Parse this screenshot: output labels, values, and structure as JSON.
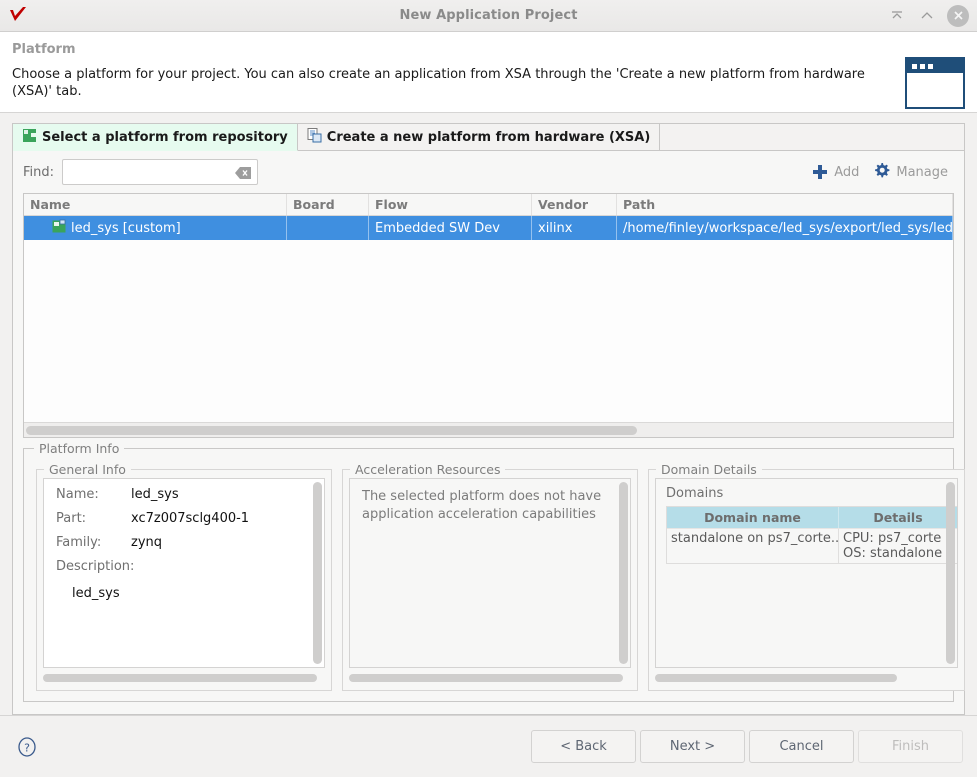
{
  "window": {
    "title": "New Application Project",
    "app_icon": "vitis-checkmark-icon",
    "controls": {
      "minimize": "collapse-icon",
      "maximize": "chevron-up-icon",
      "close": "close-icon"
    }
  },
  "header": {
    "title": "Platform",
    "description": "Choose a platform for your project. You can also create an application from XSA through the 'Create a new platform from hardware (XSA)' tab."
  },
  "tabs": [
    {
      "label": "Select a platform from repository",
      "icon": "green-platform-icon",
      "active": true
    },
    {
      "label": "Create a new platform from hardware (XSA)",
      "icon": "xsa-document-icon",
      "active": false
    }
  ],
  "find": {
    "label": "Find:",
    "value": "",
    "placeholder": "",
    "clear_icon": "clear-backspace-icon"
  },
  "toolbar": {
    "add_label": "Add",
    "add_icon": "plus-icon",
    "manage_label": "Manage",
    "manage_icon": "gear-icon"
  },
  "platform_table": {
    "columns": [
      "Name",
      "Board",
      "Flow",
      "Vendor",
      "Path"
    ],
    "rows": [
      {
        "name": "led_sys [custom]",
        "board": "",
        "flow": "Embedded SW Dev",
        "vendor": "xilinx",
        "path": "/home/finley/workspace/led_sys/export/led_sys/led_s",
        "icon": "platform-project-icon",
        "selected": true
      }
    ]
  },
  "platform_info": {
    "legend": "Platform Info",
    "general": {
      "legend": "General Info",
      "fields": [
        {
          "key": "Name:",
          "value": "led_sys"
        },
        {
          "key": "Part:",
          "value": "xc7z007sclg400-1"
        },
        {
          "key": "Family:",
          "value": "zynq"
        }
      ],
      "description_key": "Description:",
      "description_value": "led_sys"
    },
    "acceleration": {
      "legend": "Acceleration Resources",
      "message": "The selected platform does not have application acceleration capabilities"
    },
    "domain_details": {
      "legend": "Domain Details",
      "domains_label": "Domains",
      "columns": [
        "Domain name",
        "Details"
      ],
      "rows": [
        {
          "name": "standalone on ps7_corte...",
          "details_line1": "CPU: ps7_corte",
          "details_line2": "OS: standalone"
        }
      ]
    }
  },
  "footer": {
    "help_icon": "help-question-icon",
    "buttons": [
      {
        "label": "< Back",
        "enabled": true
      },
      {
        "label": "Next >",
        "enabled": true
      },
      {
        "label": "Cancel",
        "enabled": true
      },
      {
        "label": "Finish",
        "enabled": false
      }
    ]
  },
  "colors": {
    "selection_blue": "#3f8fe0",
    "active_tab_green": "#e6fbef",
    "accent_blue": "#2e5a96",
    "domain_header_blue": "#b5dde8"
  }
}
